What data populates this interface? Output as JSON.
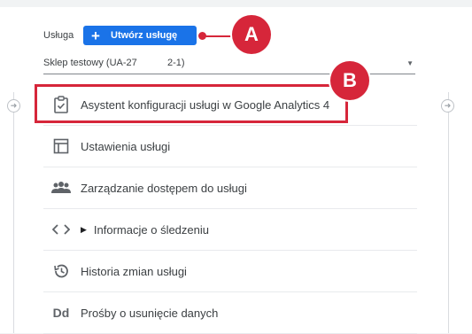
{
  "header": {
    "property_label": "Usługa",
    "create_button_label": "Utwórz usługę"
  },
  "property_select": {
    "value_part1": "Sklep testowy (UA-27",
    "value_part2": "2-1)"
  },
  "annotations": {
    "marker_a": "A",
    "marker_b": "B"
  },
  "menu": {
    "items": [
      {
        "label": "Asystent konfiguracji usługi w Google Analytics 4",
        "icon": "clipboard-check-icon"
      },
      {
        "label": "Ustawienia usługi",
        "icon": "layout-icon"
      },
      {
        "label": "Zarządzanie dostępem do usługi",
        "icon": "people-icon"
      },
      {
        "label": "Informacje o śledzeniu",
        "icon": "code-icon"
      },
      {
        "label": "Historia zmian usługi",
        "icon": "history-icon"
      },
      {
        "label": "Prośby o usunięcie danych",
        "icon": "dd-icon",
        "icon_text": "Dd"
      }
    ]
  },
  "colors": {
    "accent": "#1a73e8",
    "annotation": "#d6263a"
  }
}
